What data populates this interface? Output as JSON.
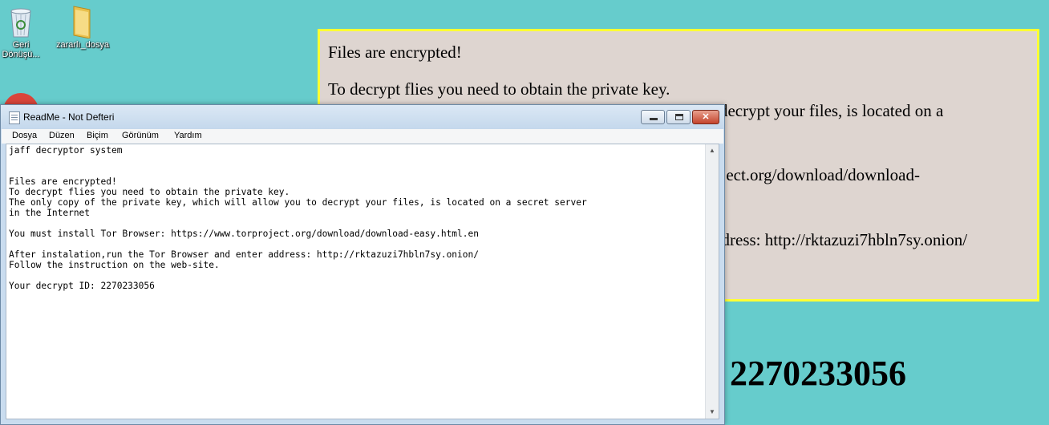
{
  "desktop": {
    "icons": [
      {
        "label": "Geri Dönüşü...",
        "icon": "recycle-bin-icon"
      },
      {
        "label": "zararlı_dosya",
        "icon": "folder-icon"
      }
    ]
  },
  "ransom_note": {
    "lines": [
      "Files are encrypted!",
      "To decrypt flies you need to obtain the private key.",
      "The only copy of the private key, which will allow you to decrypt your files, is located on a",
      "oject.org/download/download-",
      "ddress: http://rktazuzi7hbln7sy.onion/"
    ],
    "decrypt_id": "2270233056",
    "colors": {
      "background": "#ded5d0",
      "border": "#ffff33"
    }
  },
  "notepad": {
    "title": "ReadMe - Not Defteri",
    "menu": [
      "Dosya",
      "Düzen",
      "Biçim",
      "Görünüm",
      "Yardım"
    ],
    "content": "jaff decryptor system\n\n\nFiles are encrypted!\nTo decrypt flies you need to obtain the private key.\nThe only copy of the private key, which will allow you to decrypt your files, is located on a secret server\nin the Internet\n\nYou must install Tor Browser: https://www.torproject.org/download/download-easy.html.en\n\nAfter instalation,run the Tor Browser and enter address: http://rktazuzi7hbln7sy.onion/\nFollow the instruction on the web-site.\n\nYour decrypt ID: 2270233056"
  },
  "colors": {
    "desktop": "#66cccc"
  }
}
